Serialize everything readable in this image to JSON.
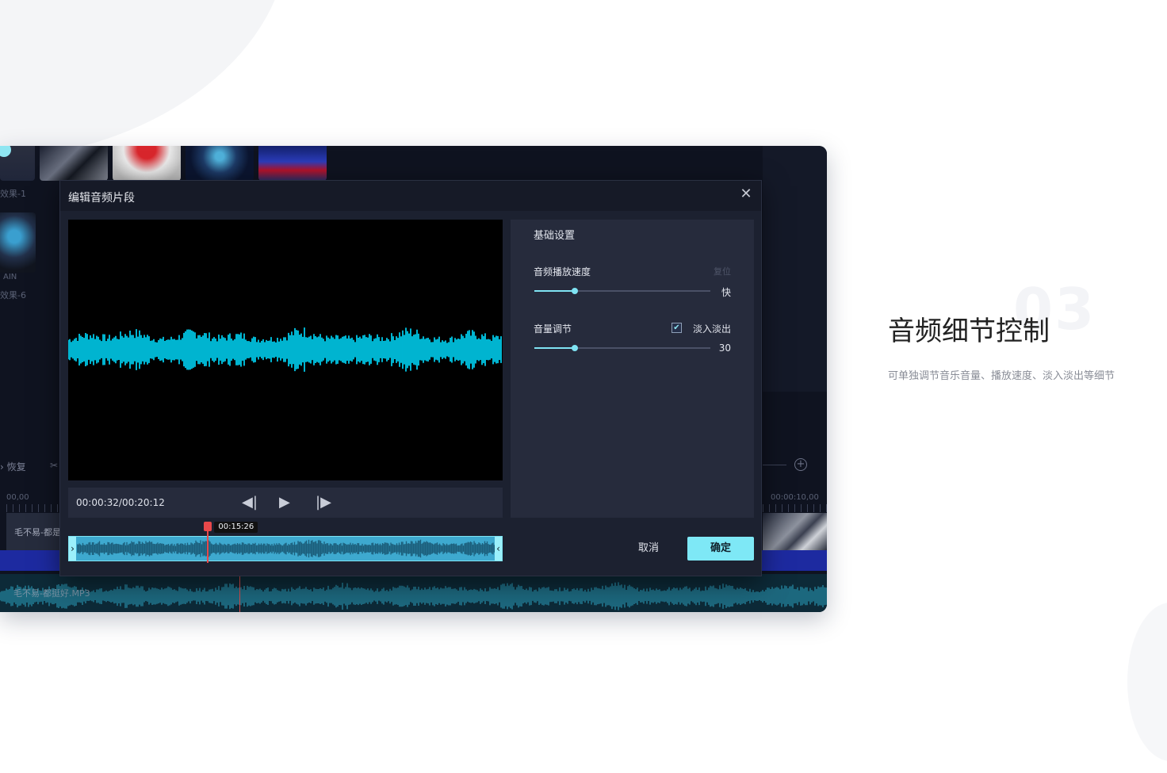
{
  "app": {
    "media_labels": [
      "效果-1",
      "效果-6"
    ],
    "thumb_caption": "AIN",
    "toolbar": {
      "recover_label": "恢复",
      "scissor_icon": "scissor-icon",
      "add_icon": "plus-circle-icon"
    },
    "ruler": {
      "left_time": "00,00",
      "right_time": "00:00:10,00"
    },
    "clip_label": "毛不易-都是",
    "audio_track_name": "毛不易-都挺好.MP3"
  },
  "dialog": {
    "title": "编辑音频片段",
    "close_icon": "close-icon",
    "time_display": "00:00:32/00:20:12",
    "prev_frame_icon": "prev-frame-icon",
    "play_icon": "play-icon",
    "next_frame_icon": "next-frame-icon",
    "playhead_time": "00:15:26",
    "playhead_fraction": 0.32,
    "settings": {
      "title": "基础设置",
      "speed_label": "音频播放速度",
      "reset_label": "复位",
      "speed_value_label": "快",
      "speed_fraction": 0.23,
      "volume_label": "音量调节",
      "fade_label": "淡入淡出",
      "fade_checked": true,
      "volume_value": "30",
      "volume_fraction": 0.23
    },
    "cancel_label": "取消",
    "ok_label": "确定"
  },
  "feature": {
    "number": "03",
    "title": "音频细节控制",
    "description": "可单独调节音乐音量、播放速度、淡入淡出等细节"
  },
  "colors": {
    "accent": "#7ee8f6",
    "waveform": "#00c8e8",
    "playhead": "#e8484a"
  }
}
